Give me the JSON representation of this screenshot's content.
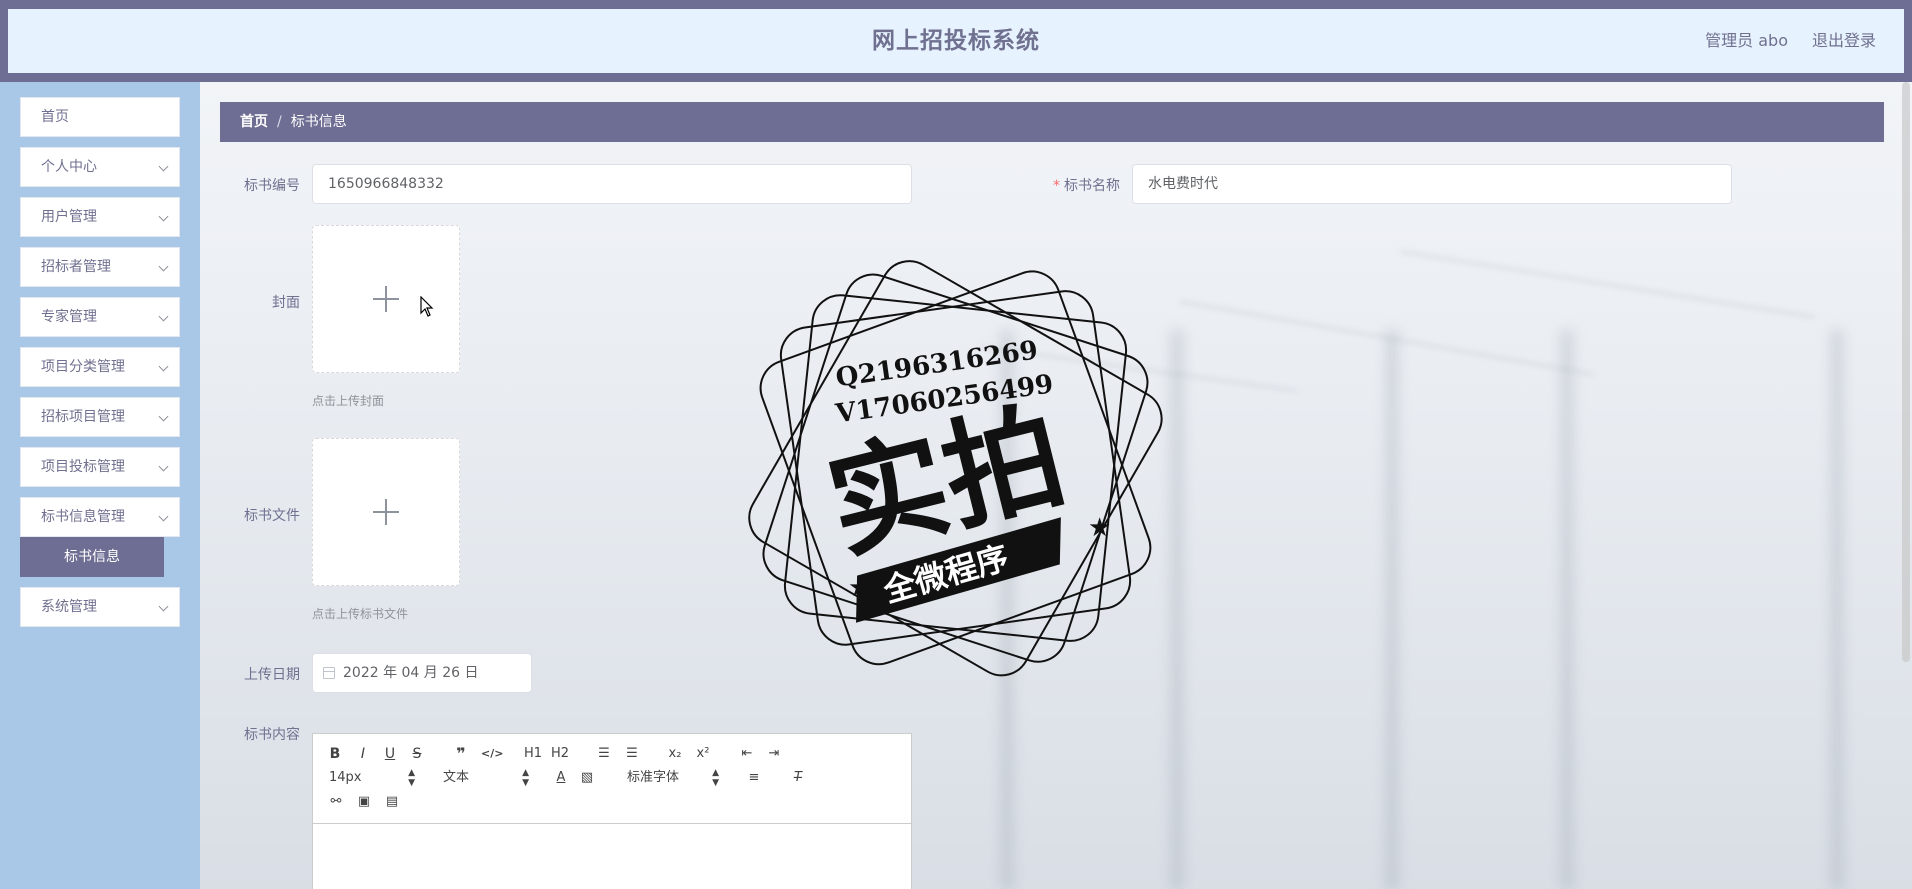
{
  "header": {
    "title": "网上招投标系统",
    "user_label": "管理员 abo",
    "logout_label": "退出登录"
  },
  "sidebar": {
    "items": [
      {
        "label": "首页",
        "has_chevron": false
      },
      {
        "label": "个人中心",
        "has_chevron": true
      },
      {
        "label": "用户管理",
        "has_chevron": true
      },
      {
        "label": "招标者管理",
        "has_chevron": true
      },
      {
        "label": "专家管理",
        "has_chevron": true
      },
      {
        "label": "项目分类管理",
        "has_chevron": true
      },
      {
        "label": "招标项目管理",
        "has_chevron": true
      },
      {
        "label": "项目投标管理",
        "has_chevron": true
      },
      {
        "label": "标书信息管理",
        "has_chevron": true
      },
      {
        "label": "系统管理",
        "has_chevron": true
      }
    ],
    "active_sub": "标书信息"
  },
  "breadcrumb": {
    "home": "首页",
    "separator": "/",
    "current": "标书信息"
  },
  "form": {
    "number_label": "标书编号",
    "number_value": "1650966848332",
    "name_label": "标书名称",
    "name_required": "*",
    "name_value": "水电费时代",
    "cover_label": "封面",
    "cover_tip": "点击上传封面",
    "file_label": "标书文件",
    "file_tip": "点击上传标书文件",
    "date_label": "上传日期",
    "date_value": "2022 年 04 月 26 日",
    "content_label": "标书内容"
  },
  "editor": {
    "font_size": "14px",
    "paragraph": "文本",
    "font_family": "标准字体",
    "buttons": {
      "bold": "B",
      "italic": "I",
      "underline": "U",
      "strike": "S",
      "h1": "H1",
      "h2": "H2",
      "sub": "x₂",
      "sup": "x²"
    }
  },
  "watermark": {
    "line1": "Q2196316269",
    "line2": "V17060256499",
    "main": "实拍",
    "banner": "全微程序"
  },
  "colors": {
    "accent": "#6e6d93",
    "header_bg": "#e6f2fd",
    "sidebar_bg": "#a9c8e8",
    "required": "#f56c6c"
  }
}
